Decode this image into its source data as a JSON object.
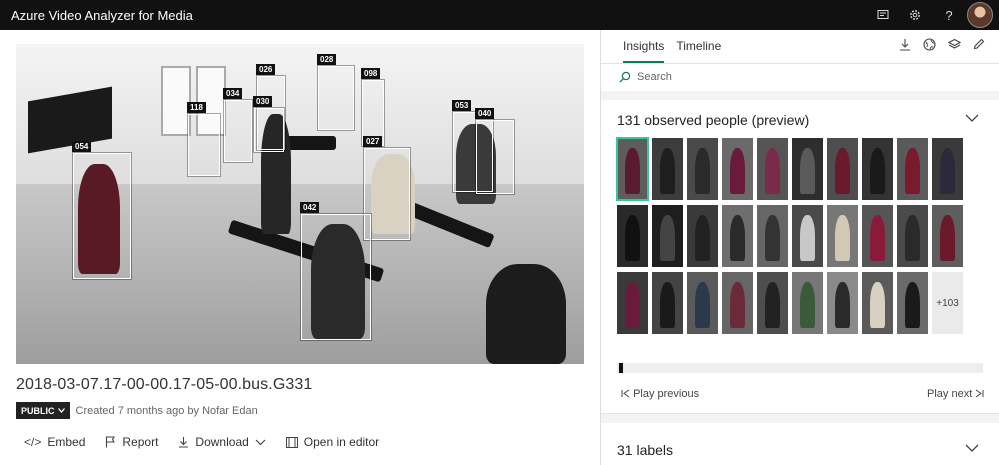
{
  "app": {
    "title": "Azure Video Analyzer for Media"
  },
  "topbar": {
    "icons": [
      "feedback-icon",
      "settings-icon",
      "help-icon"
    ],
    "help_glyph": "?",
    "avatar": "user-avatar"
  },
  "video": {
    "detections": [
      "054",
      "118",
      "034",
      "026",
      "030",
      "028",
      "098",
      "027",
      "053",
      "040",
      "042"
    ]
  },
  "details": {
    "title": "2018-03-07.17-00-00.17-05-00.bus.G331",
    "visibility": "PUBLIC",
    "created": "Created 7 months ago by Nofar Edan"
  },
  "actions": {
    "embed": "Embed",
    "report": "Report",
    "download": "Download",
    "open_editor": "Open in editor"
  },
  "insights_panel": {
    "tabs": [
      "Insights",
      "Timeline"
    ],
    "active_tab": "Insights",
    "search_placeholder": "Search",
    "people": {
      "title": "131 observed people (preview)",
      "more": "+103"
    },
    "play_previous": "Play previous",
    "play_next": "Play next",
    "labels": {
      "title": "31 labels"
    }
  },
  "colors": {
    "accent": "#0e7a5e",
    "selected_outline": "#34c7a0",
    "topbar_bg": "#111111"
  }
}
